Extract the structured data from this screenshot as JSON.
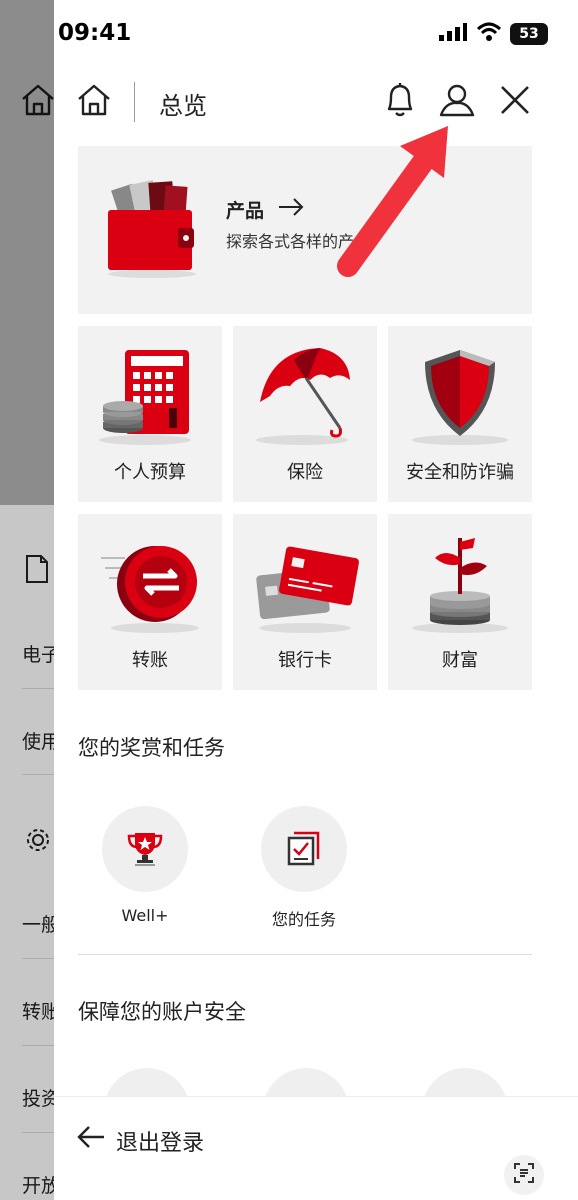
{
  "status_bar": {
    "time": "09:41",
    "battery": "53"
  },
  "background": {
    "items": [
      "电子",
      "使用",
      "一般",
      "转账",
      "投资",
      "开放"
    ]
  },
  "header": {
    "title": "总览"
  },
  "products": {
    "title": "产品",
    "subtitle": "探索各式各样的产"
  },
  "tiles": [
    {
      "label": "个人预算",
      "icon": "calculator-icon"
    },
    {
      "label": "保险",
      "icon": "umbrella-icon"
    },
    {
      "label": "安全和防诈骗",
      "icon": "shield-icon"
    },
    {
      "label": "转账",
      "icon": "transfer-coin-icon"
    },
    {
      "label": "银行卡",
      "icon": "bank-card-icon"
    },
    {
      "label": "财富",
      "icon": "wealth-coins-icon"
    }
  ],
  "rewards": {
    "title": "您的奖赏和任务",
    "items": [
      {
        "label": "Well+",
        "icon": "trophy-icon"
      },
      {
        "label": "您的任务",
        "icon": "tasks-icon"
      }
    ]
  },
  "security": {
    "title": "保障您的账户安全"
  },
  "footer": {
    "logout_label": "退出登录"
  },
  "colors": {
    "brand_red": "#DB0011",
    "arrow_red": "#F0323C",
    "tile_bg": "#F2F2F2"
  }
}
